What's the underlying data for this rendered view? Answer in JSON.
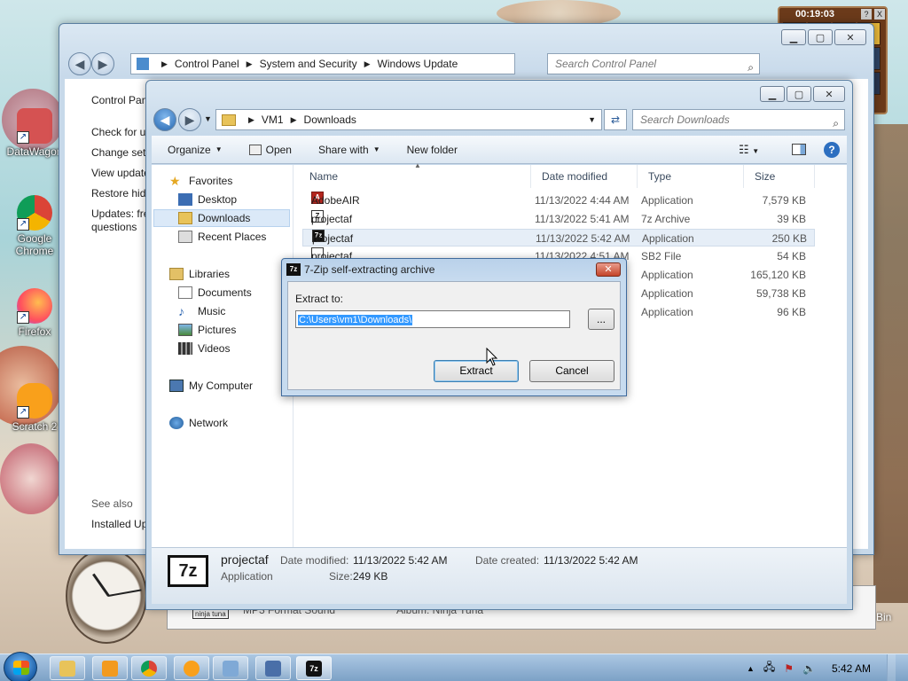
{
  "desktop": {
    "icons": [
      {
        "label": "DataWagon",
        "color": "#c83a3a"
      },
      {
        "label": "Google Chrome",
        "color": "#4285f4"
      },
      {
        "label": "Firefox",
        "color": "#ff7139"
      },
      {
        "label": "Scratch 2",
        "color": "#f7a41d"
      }
    ],
    "recycle_label": "Bin"
  },
  "gadget": {
    "time": "00:19:03",
    "help": "?",
    "close": "X"
  },
  "control_panel": {
    "breadcrumb": [
      "Control Panel",
      "System and Security",
      "Windows Update"
    ],
    "search_placeholder": "Search Control Panel",
    "sidebar": [
      "Control Pan",
      "Check for u",
      "Change sett",
      "View update",
      "Restore hid",
      "Updates: fre",
      "questions"
    ],
    "see_also": "See also",
    "installed": "Installed Up"
  },
  "music_peek": {
    "left": "MP3 Format Sound",
    "right": "Album: Ninja Tuna",
    "badge": "ninja tuna"
  },
  "explorer": {
    "breadcrumb": [
      "VM1",
      "Downloads"
    ],
    "search_placeholder": "Search Downloads",
    "toolbar": {
      "organize": "Organize",
      "open": "Open",
      "share": "Share with",
      "new_folder": "New folder",
      "help": "?"
    },
    "nav": {
      "favorites": "Favorites",
      "desktop": "Desktop",
      "downloads": "Downloads",
      "recent": "Recent Places",
      "libraries": "Libraries",
      "documents": "Documents",
      "music": "Music",
      "pictures": "Pictures",
      "videos": "Videos",
      "computer": "My Computer",
      "network": "Network"
    },
    "columns": {
      "name": "Name",
      "date": "Date modified",
      "type": "Type",
      "size": "Size"
    },
    "rows": [
      {
        "name": "AdobeAIR",
        "date": "11/13/2022 4:44 AM",
        "type": "Application",
        "size": "7,579 KB",
        "icon": "A"
      },
      {
        "name": "projectaf",
        "date": "11/13/2022 5:41 AM",
        "type": "7z Archive",
        "size": "39 KB",
        "icon": "Z"
      },
      {
        "name": "projectaf",
        "date": "11/13/2022 5:42 AM",
        "type": "Application",
        "size": "250 KB",
        "icon": "7z"
      },
      {
        "name": "projectaf",
        "date": "11/13/2022 4:51 AM",
        "type": "SB2 File",
        "size": "54 KB",
        "icon": ""
      },
      {
        "name": "",
        "date": "",
        "type": "Application",
        "size": "165,120 KB",
        "icon": ""
      },
      {
        "name": "",
        "date": "",
        "type": "Application",
        "size": "59,738 KB",
        "icon": ""
      },
      {
        "name": "",
        "date": "",
        "type": "Application",
        "size": "96 KB",
        "icon": ""
      }
    ],
    "details": {
      "icon_text": "7z",
      "name": "projectaf",
      "kind": "Application",
      "modified_label": "Date modified:",
      "modified": "11/13/2022 5:42 AM",
      "size_label": "Size:",
      "size": "249 KB",
      "created_label": "Date created:",
      "created": "11/13/2022 5:42 AM"
    }
  },
  "dialog": {
    "title": "7-Zip self-extracting archive",
    "icon_text": "7z",
    "extract_label": "Extract to:",
    "path": "C:\\Users\\vm1\\Downloads\\",
    "browse": "...",
    "extract_btn": "Extract",
    "cancel_btn": "Cancel"
  },
  "taskbar": {
    "time": "5:42 AM",
    "active_icon": "7z"
  },
  "colors": {
    "accent": "#3399ff",
    "selection": "#3399ff"
  }
}
